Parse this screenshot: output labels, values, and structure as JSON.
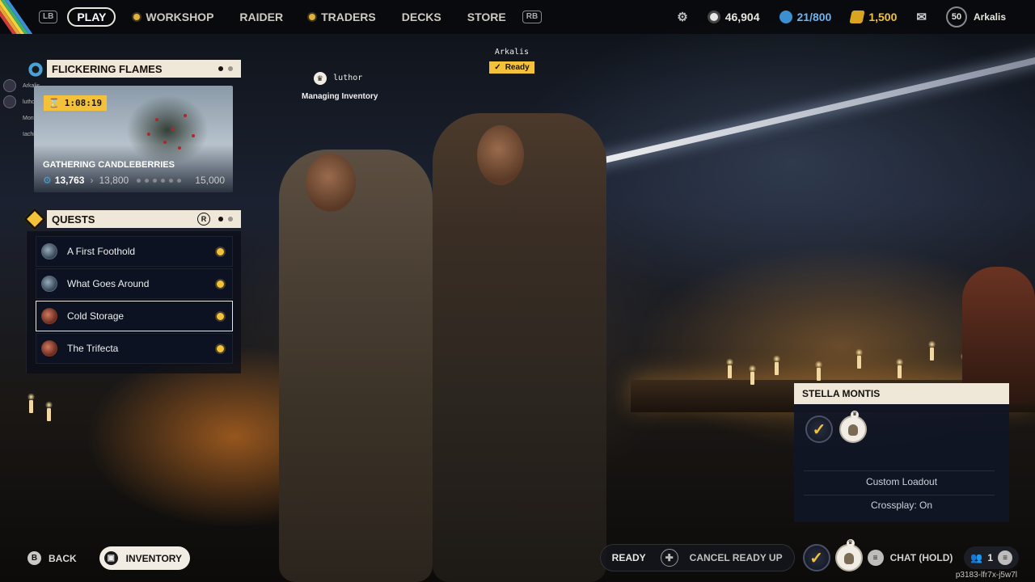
{
  "topbar": {
    "lb": "LB",
    "rb": "RB",
    "play": "PLAY",
    "nav": [
      {
        "label": "WORKSHOP",
        "alert": true
      },
      {
        "label": "RAIDER",
        "alert": false
      },
      {
        "label": "TRADERS",
        "alert": true
      },
      {
        "label": "DECKS",
        "alert": false
      },
      {
        "label": "STORE",
        "alert": false
      }
    ],
    "currencies": {
      "coins": "46,904",
      "storage": "21/800",
      "credits": "1,500"
    },
    "level": "50",
    "player_name": "Arkalis"
  },
  "party_list": [
    "Arkalis",
    "luthor",
    "Monty",
    "Iachie"
  ],
  "event": {
    "title": "FLICKERING FLAMES",
    "timer": "1:08:19",
    "activity": "GATHERING CANDLEBERRIES",
    "current": "13,763",
    "next": "13,800",
    "goal": "15,000"
  },
  "quests": {
    "title": "QUESTS",
    "r_hint": "R",
    "items": [
      {
        "label": "A First Foothold",
        "icon": "map-icon",
        "selected": false
      },
      {
        "label": "What Goes Around",
        "icon": "map-icon",
        "selected": false
      },
      {
        "label": "Cold Storage",
        "icon": "trader-icon",
        "selected": true
      },
      {
        "label": "The Trifecta",
        "icon": "trader-icon",
        "selected": false
      }
    ]
  },
  "players": {
    "luthor": {
      "name": "luthor",
      "status": "Managing Inventory"
    },
    "arkalis": {
      "name": "Arkalis",
      "status": "Ready"
    }
  },
  "party_card": {
    "title": "STELLA MONTIS",
    "loadout": "Custom Loadout",
    "crossplay": "Crossplay: On"
  },
  "bottom": {
    "back_hint": "B",
    "back": "BACK",
    "inventory": "INVENTORY",
    "ready": "READY",
    "cancel": "CANCEL READY UP",
    "chat": "CHAT (HOLD)",
    "friends": "1",
    "session": "p3183-lfr7x-j5w7l"
  },
  "colors": {
    "accent": "#f3c23a",
    "panel": "#efe7d7"
  }
}
